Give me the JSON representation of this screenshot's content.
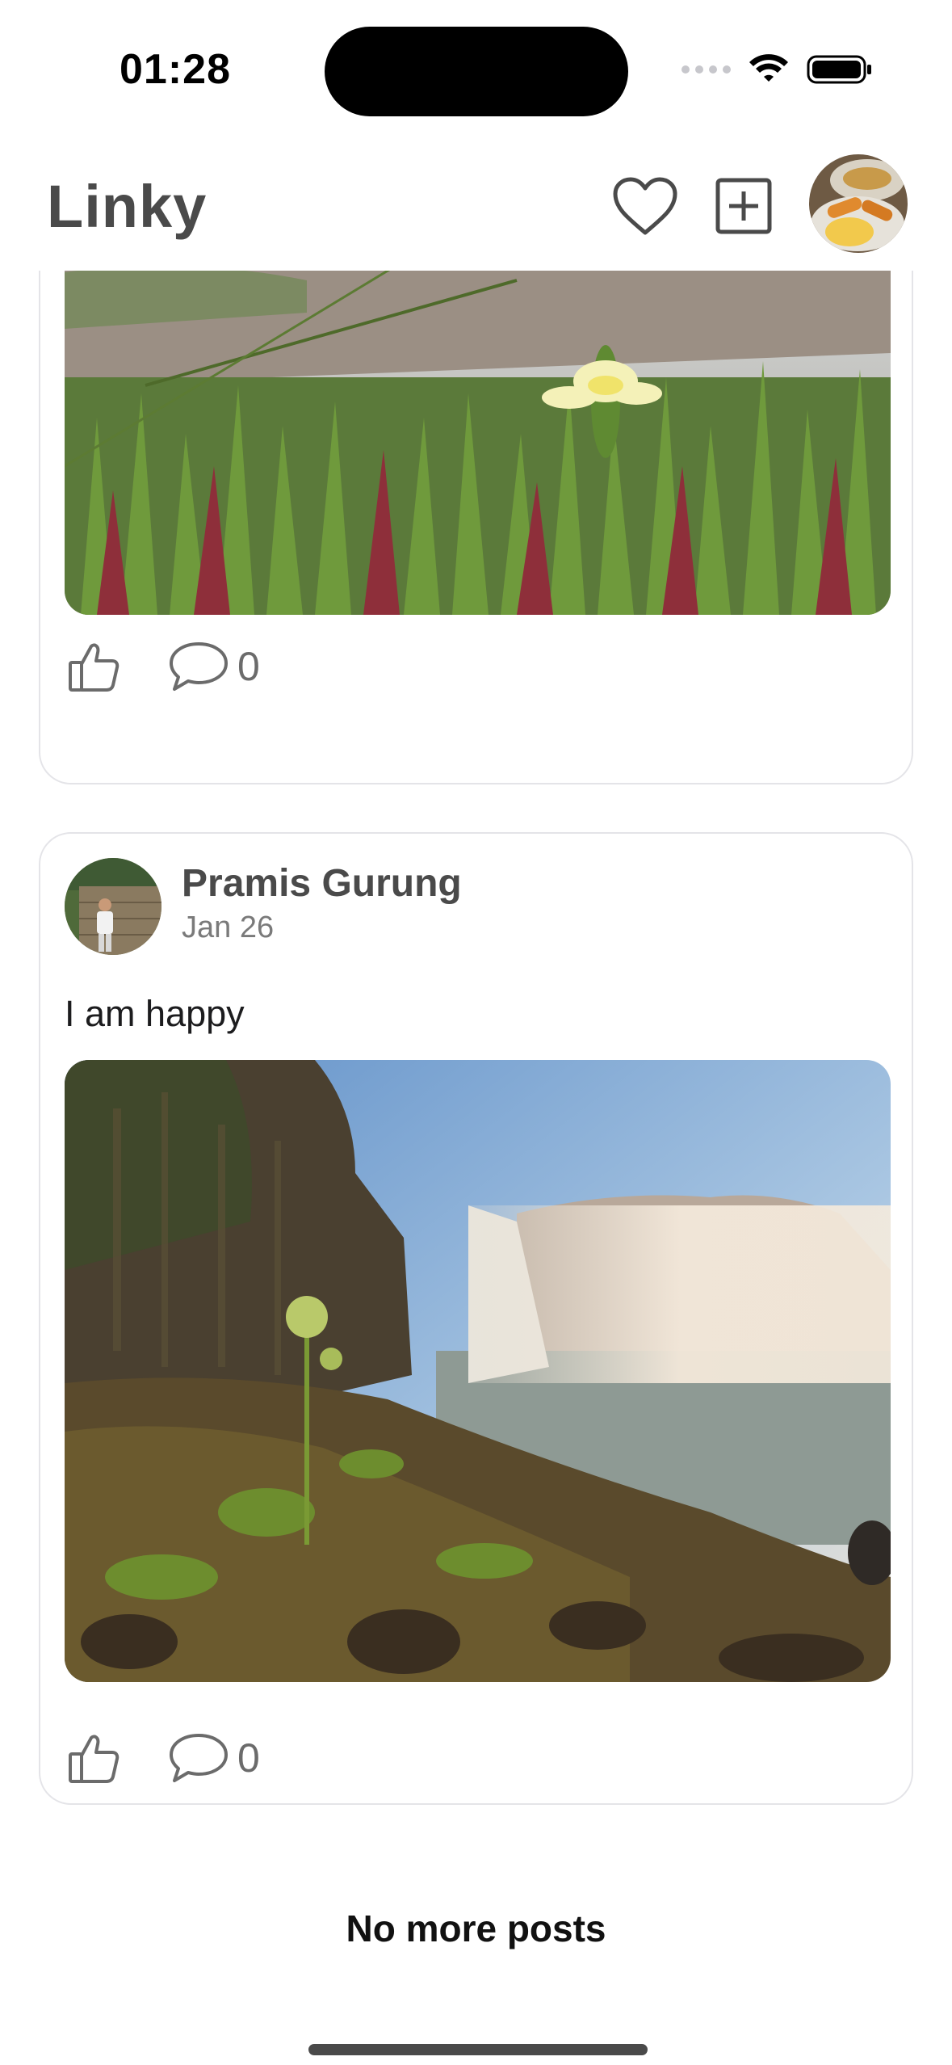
{
  "status_bar": {
    "time": "01:28"
  },
  "header": {
    "title": "Linky",
    "icons": [
      "heart-icon",
      "plus-square-icon"
    ]
  },
  "posts": [
    {
      "image": "sand-dune-succulent-flower-photo",
      "likes_icon": "thumbs-up-icon",
      "comment_count": "0"
    },
    {
      "author": "Pramis Gurung",
      "date": "Jan 26",
      "text": "I am happy",
      "image": "waterfall-landscape-photo",
      "likes_icon": "thumbs-up-icon",
      "comment_count": "0"
    }
  ],
  "feed_end": {
    "message": "No more posts"
  },
  "colors": {
    "text_primary": "#1c1c1e",
    "title_gray": "#4a4a4a",
    "icon_gray": "#6b6b6b",
    "card_border": "#e4e4e8"
  }
}
